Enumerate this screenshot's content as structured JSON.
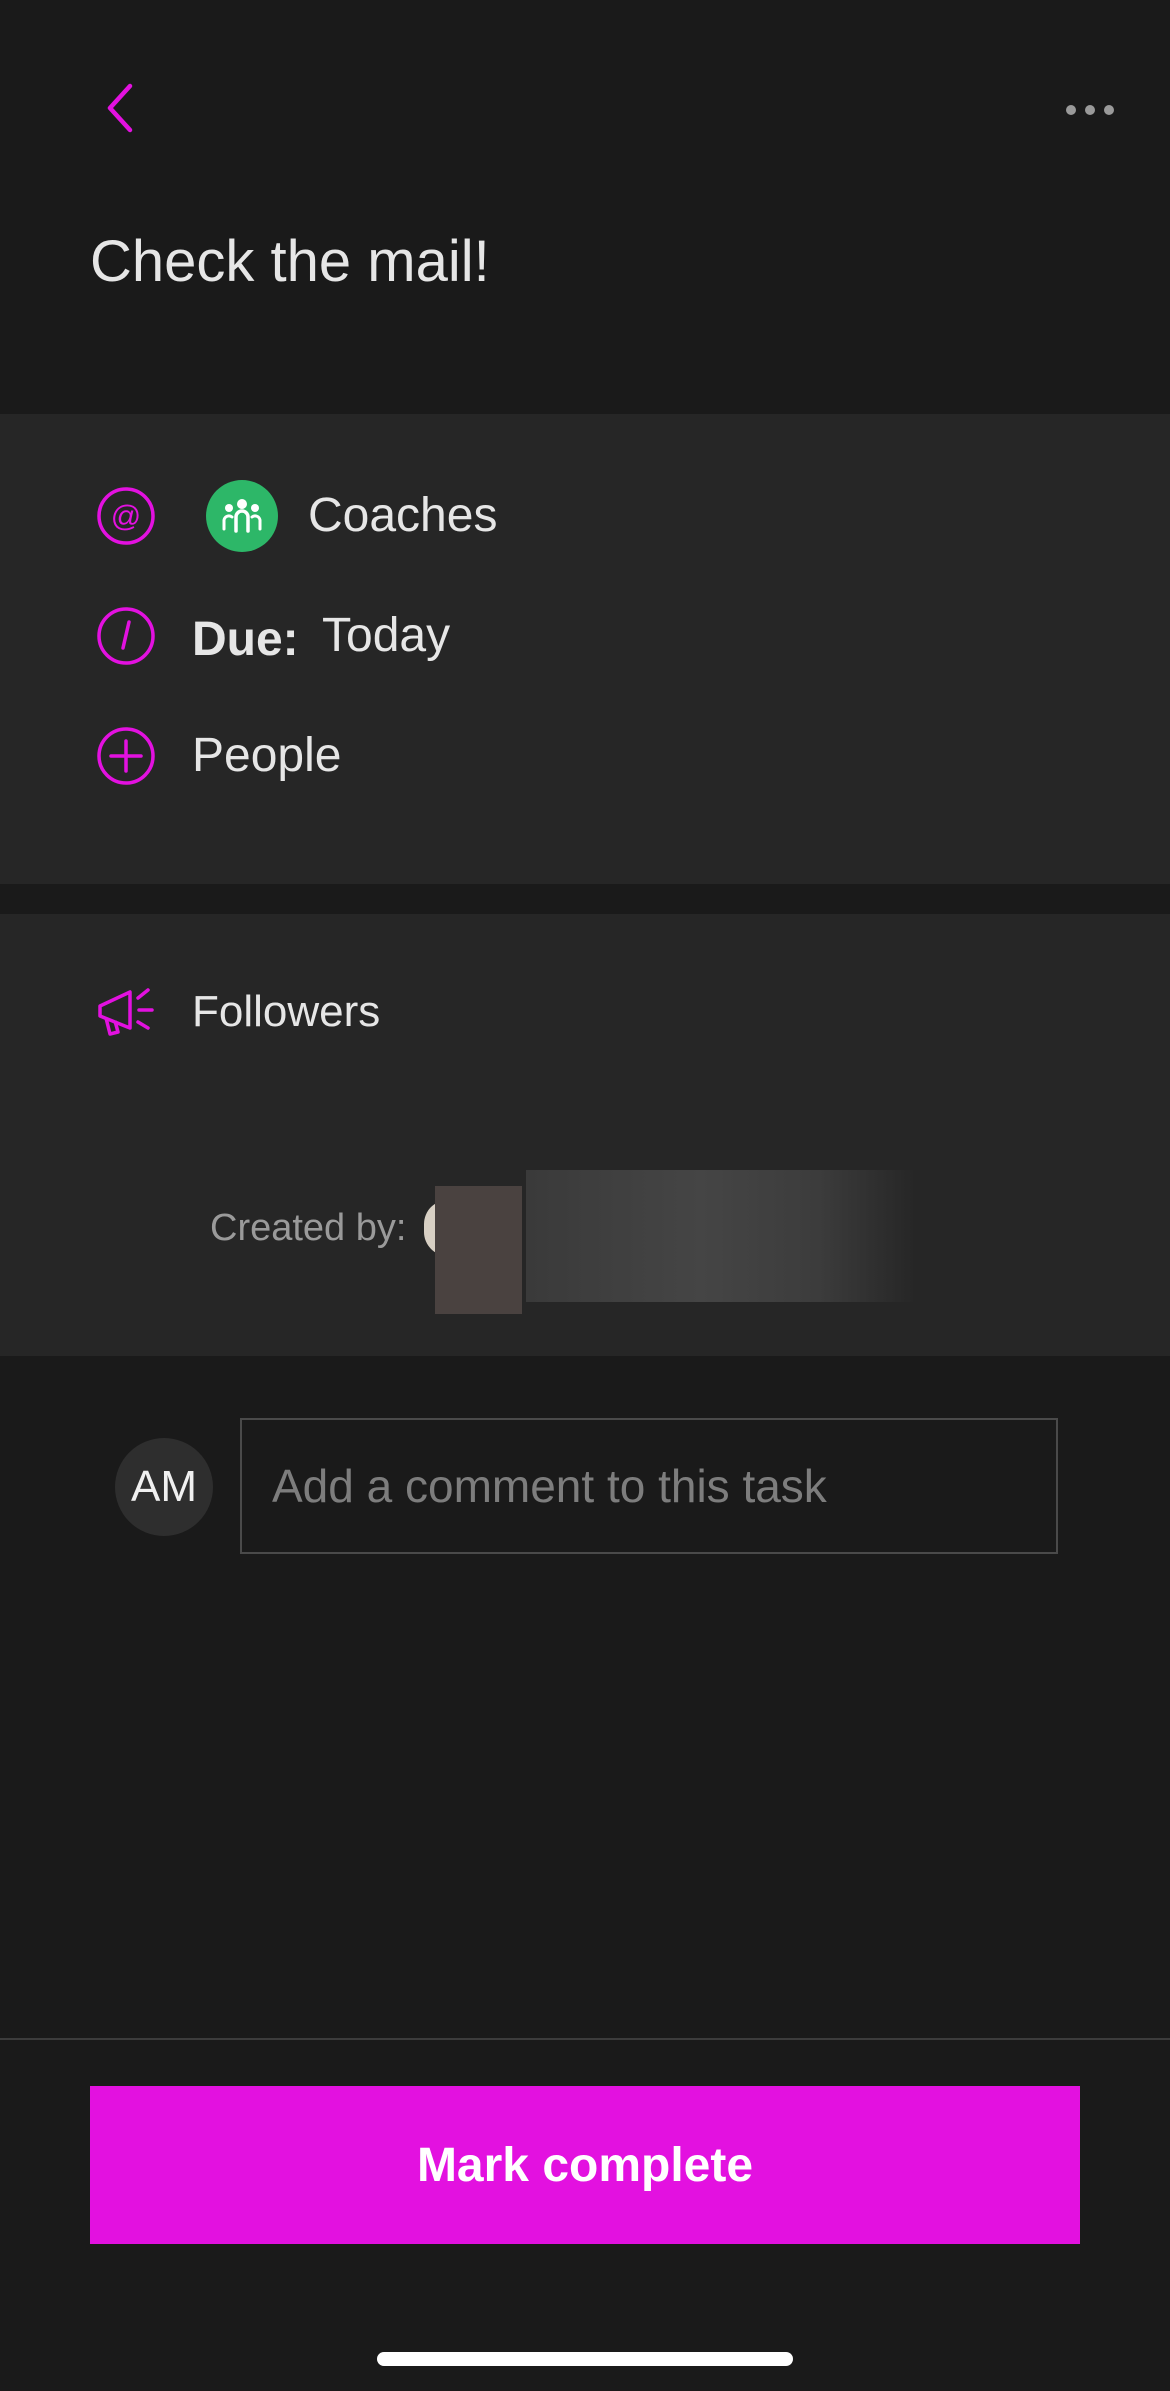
{
  "header": {
    "back_icon": "chevron-left-icon",
    "more_icon": "ellipsis-icon",
    "title": "Check the mail!"
  },
  "details": {
    "assignee": {
      "icon": "at-sign-icon",
      "team_icon": "group-icon",
      "label": "Coaches"
    },
    "due": {
      "icon": "clock-icon",
      "label": "Due:",
      "value": "Today"
    },
    "people": {
      "icon": "plus-circle-icon",
      "label": "People"
    }
  },
  "followers": {
    "icon": "megaphone-icon",
    "label": "Followers",
    "created_by_label": "Created by:"
  },
  "comment": {
    "avatar_initials": "AM",
    "placeholder": "Add a comment to this task"
  },
  "footer": {
    "mark_complete_label": "Mark complete"
  },
  "colors": {
    "accent": "#e311e0",
    "background": "#1a1a1a",
    "panel": "#262626",
    "team_green": "#2db768"
  }
}
